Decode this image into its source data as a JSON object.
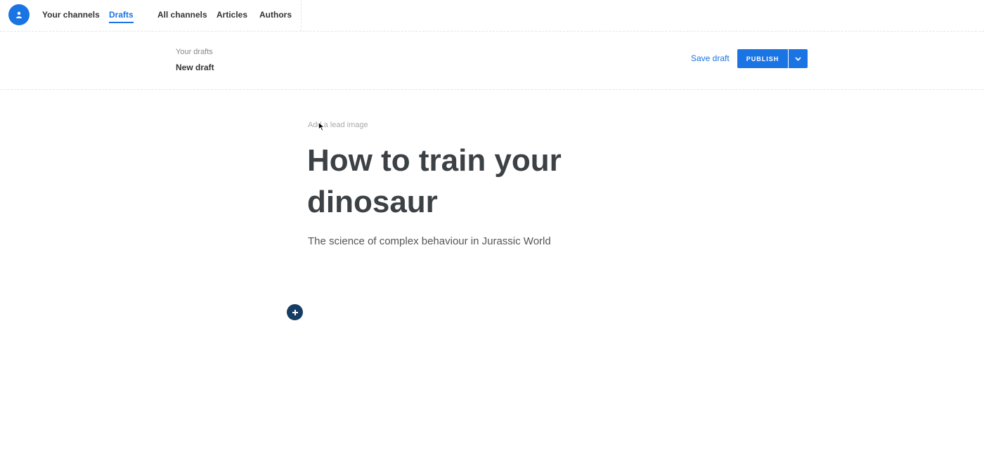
{
  "topnav": {
    "avatar_icon": "user-icon",
    "links": [
      {
        "label": "Your channels",
        "active": false
      },
      {
        "label": "Drafts",
        "active": true
      },
      {
        "label": "All channels",
        "active": false
      },
      {
        "label": "Articles",
        "active": false
      },
      {
        "label": "Authors",
        "active": false
      }
    ]
  },
  "subheader": {
    "breadcrumb": "Your drafts",
    "title": "New draft",
    "save_label": "Save draft",
    "publish_label": "PUBLISH",
    "publish_menu_icon": "chevron-down-icon"
  },
  "editor": {
    "lead_image_label": "Add a lead image",
    "title": "How to train your dinosaur",
    "subtitle": "The science of complex behaviour in Jurassic World",
    "add_block_icon": "plus-icon"
  },
  "colors": {
    "accent": "#1b74e4",
    "add_button": "#163d63",
    "title": "#3b4145"
  }
}
